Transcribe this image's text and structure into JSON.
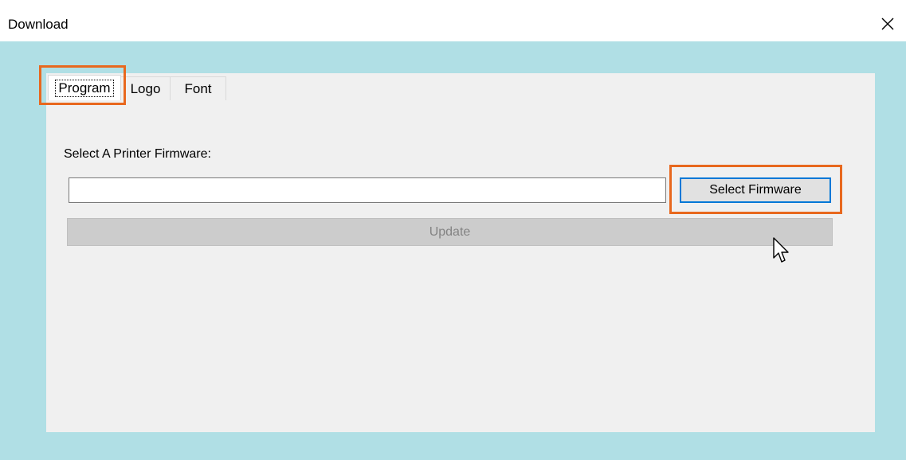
{
  "window": {
    "title": "Download",
    "close_icon": "close-icon"
  },
  "tabs": [
    {
      "label": "Program",
      "active": true
    },
    {
      "label": "Logo",
      "active": false
    },
    {
      "label": "Font",
      "active": false
    }
  ],
  "program": {
    "firmware_label": "Select A Printer Firmware:",
    "firmware_path": "",
    "select_button": "Select Firmware",
    "update_button": "Update"
  },
  "colors": {
    "background": "#b0dfe5",
    "panel": "#f0f0f0",
    "highlight": "#e8681e",
    "focus_border": "#0078d7"
  }
}
